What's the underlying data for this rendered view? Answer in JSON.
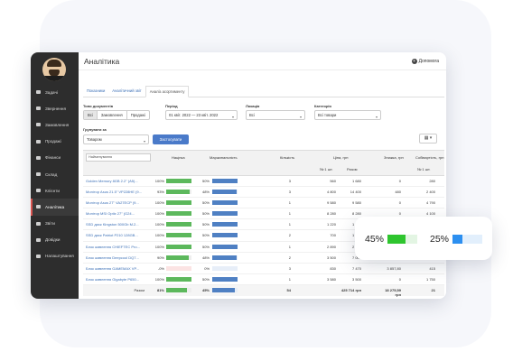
{
  "window": {
    "title": "Аналітика",
    "help_label": "Допомога"
  },
  "colors": {
    "accent_red": "#d9534f",
    "green": "#5cb85c",
    "blue": "#4f80c3",
    "apply": "#4a7ac9"
  },
  "sidebar": {
    "items": [
      {
        "label": "Задачі",
        "icon": "tasks-icon"
      },
      {
        "label": "Звернення",
        "icon": "inbox-icon"
      },
      {
        "label": "Замовлення",
        "icon": "orders-icon"
      },
      {
        "label": "Продажі",
        "icon": "cart-icon"
      },
      {
        "label": "Фінанси",
        "icon": "money-icon"
      },
      {
        "label": "Склад",
        "icon": "warehouse-icon"
      },
      {
        "label": "Клієнти",
        "icon": "clients-icon"
      },
      {
        "label": "Аналітика",
        "icon": "analytics-icon",
        "active": true
      },
      {
        "label": "Звіти",
        "icon": "reports-icon"
      },
      {
        "label": "Довідки",
        "icon": "reference-icon"
      },
      {
        "label": "Налаштування",
        "icon": "settings-icon"
      }
    ]
  },
  "tabs": [
    "Показники",
    "Аналітичний звіт",
    "Аналіз асортименту"
  ],
  "filters": {
    "doc_types_label": "Типи документів",
    "doc_types": [
      "Всі",
      "Замовлення",
      "Продажі"
    ],
    "period_label": "Період",
    "period_value": "01 квіт. 2022 — 23 квіт. 2022",
    "location_label": "Локація",
    "location_value": "Всі",
    "category_label": "Категорія",
    "category_value": "Всі товари",
    "group_label": "Групувати за",
    "group_value": "Товаром",
    "apply_label": "Застосувати",
    "grid_icon": "grid-icon"
  },
  "table": {
    "col_name": "Найменування",
    "col_markup": "Націнка",
    "col_margin": "Маржинальність",
    "col_qty": "Кількість",
    "col_price": "Ціна, грн",
    "col_price_per": "№ 1 шт.",
    "col_price_total": "Разом",
    "col_discount": "Знижка, грн",
    "col_cost": "Собівартість, грн",
    "col_cost_per": "№ 1 шт.",
    "rows": [
      {
        "name": "Golden Memory 8GB 2.2\" (A5)...",
        "markup": "100%",
        "markup_v": 1.0,
        "margin": "50%",
        "margin_v": 0.5,
        "qty": "3",
        "price": "560",
        "total": "1 680",
        "disc": "0",
        "cost": "280"
      },
      {
        "name": "Монітор Asus 21.5\" VP228HE (9...",
        "markup": "93%",
        "markup_v": 0.93,
        "margin": "48%",
        "margin_v": 0.48,
        "qty": "3",
        "price": "4 800",
        "total": "14 400",
        "disc": "480",
        "cost": "2 400"
      },
      {
        "name": "Монітор Asus 27\" VA27ECP (9...",
        "markup": "100%",
        "markup_v": 1.0,
        "margin": "50%",
        "margin_v": 0.5,
        "qty": "1",
        "price": "9 580",
        "total": "9 580",
        "disc": "0",
        "cost": "4 790"
      },
      {
        "name": "Монітор MSI Optix 27\" (G24...",
        "markup": "100%",
        "markup_v": 1.0,
        "margin": "50%",
        "margin_v": 0.5,
        "qty": "1",
        "price": "8 280",
        "total": "8 280",
        "disc": "0",
        "cost": "4 100"
      },
      {
        "name": "SSD диск Kingston 500Gb M.2...",
        "markup": "100%",
        "markup_v": 1.0,
        "margin": "50%",
        "margin_v": 0.5,
        "qty": "1",
        "price": "1 220",
        "total": "1 220",
        "disc": "0",
        "cost": "610"
      },
      {
        "name": "SSD диск Patriot P210 128GB...",
        "markup": "100%",
        "markup_v": 1.0,
        "margin": "50%",
        "margin_v": 0.5,
        "qty": "2",
        "price": "700",
        "total": "1 400",
        "disc": "0",
        "cost": "350"
      },
      {
        "name": "Блок живлення CHIEFTEC Pro...",
        "markup": "100%",
        "markup_v": 1.0,
        "margin": "50%",
        "margin_v": 0.5,
        "qty": "1",
        "price": "2 890",
        "total": "2 890",
        "disc": "0",
        "cost": "1 450"
      },
      {
        "name": "Блок живлення Deepcool DQ7...",
        "markup": "90%",
        "markup_v": 0.9,
        "margin": "48%",
        "margin_v": 0.48,
        "qty": "2",
        "price": "3 500",
        "total": "7 000",
        "disc": "350",
        "cost": "1 750"
      },
      {
        "name": "Блок живлення GAMEMAX VP...",
        "markup": "-0%",
        "markup_v": 0.0,
        "margin": "0%",
        "margin_v": 0.0,
        "qty": "3",
        "price": "830",
        "total": "7 470",
        "disc": "3 857,80",
        "cost": "415"
      },
      {
        "name": "Блок живлення Gigabyte P650...",
        "markup": "100%",
        "markup_v": 1.0,
        "margin": "50%",
        "margin_v": 0.5,
        "qty": "1",
        "price": "3 580",
        "total": "3 500",
        "disc": "0",
        "cost": "1 750"
      }
    ],
    "total": {
      "label": "Разом",
      "markup": "81%",
      "markup_v": 0.81,
      "margin": "45%",
      "margin_v": 0.45,
      "qty": "54",
      "price": "",
      "total": "425 714 грн",
      "disc": "18 275,59 грн",
      "cost": "21"
    }
  },
  "float_card": {
    "left": {
      "label": "45%",
      "value": 0.45,
      "color": "#2ec52e"
    },
    "right": {
      "label": "25%",
      "value": 0.25,
      "color": "#2c8ff0"
    }
  }
}
